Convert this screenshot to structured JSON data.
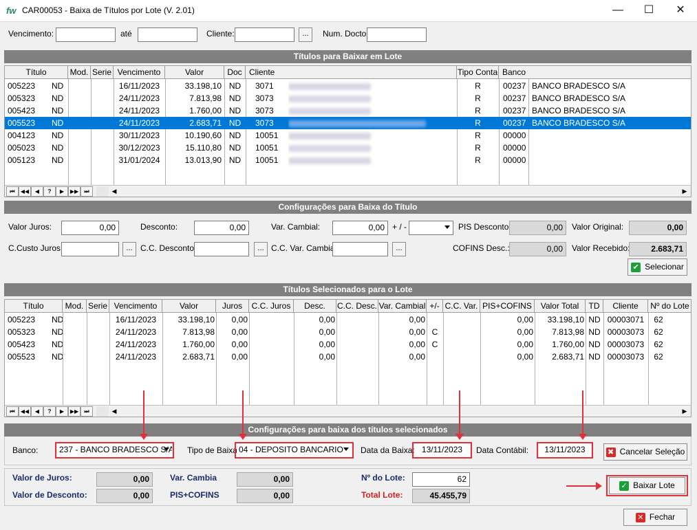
{
  "window": {
    "app_icon": "fw",
    "title": "CAR00053 - Baixa de Títulos por Lote   (V. 2.01)",
    "minimize": "—",
    "maximize": "☐",
    "close": "✕"
  },
  "filters": {
    "vencimento_label": "Vencimento:",
    "vencimento_from": "",
    "ate_label": "até",
    "vencimento_to": "",
    "cliente_label": "Cliente:",
    "cliente_value": "",
    "cliente_lookup": "...",
    "num_docto_label": "Num. Docto",
    "num_docto_value": ""
  },
  "titulos_baixar": {
    "section_title": "Títulos para Baixar em Lote",
    "headers": [
      "Título",
      "Mod.",
      "Serie",
      "Vencimento",
      "Valor",
      "Doc",
      "Cliente",
      "Tipo Conta",
      "Banco"
    ],
    "rows": [
      {
        "titulo": "005223",
        "tipo": "ND",
        "mod": "",
        "serie": "",
        "vencimento": "16/11/2023",
        "valor": "33.198,10",
        "doc": "ND",
        "cliente": "3071",
        "tipo_conta": "R",
        "banco": "00237",
        "banco_nome": "BANCO BRADESCO S/A",
        "selected": false
      },
      {
        "titulo": "005323",
        "tipo": "ND",
        "mod": "",
        "serie": "",
        "vencimento": "24/11/2023",
        "valor": "7.813,98",
        "doc": "ND",
        "cliente": "3073",
        "tipo_conta": "R",
        "banco": "00237",
        "banco_nome": "BANCO BRADESCO S/A",
        "selected": false
      },
      {
        "titulo": "005423",
        "tipo": "ND",
        "mod": "",
        "serie": "",
        "vencimento": "24/11/2023",
        "valor": "1.760,00",
        "doc": "ND",
        "cliente": "3073",
        "tipo_conta": "R",
        "banco": "00237",
        "banco_nome": "BANCO BRADESCO S/A",
        "selected": false
      },
      {
        "titulo": "005523",
        "tipo": "ND",
        "mod": "",
        "serie": "",
        "vencimento": "24/11/2023",
        "valor": "2.683,71",
        "doc": "ND",
        "cliente": "3073",
        "tipo_conta": "R",
        "banco": "00237",
        "banco_nome": "BANCO BRADESCO S/A",
        "selected": true
      },
      {
        "titulo": "004123",
        "tipo": "ND",
        "mod": "",
        "serie": "",
        "vencimento": "30/11/2023",
        "valor": "10.190,60",
        "doc": "ND",
        "cliente": "10051",
        "tipo_conta": "R",
        "banco": "00000",
        "banco_nome": "",
        "selected": false
      },
      {
        "titulo": "005023",
        "tipo": "ND",
        "mod": "",
        "serie": "",
        "vencimento": "30/12/2023",
        "valor": "15.110,80",
        "doc": "ND",
        "cliente": "10051",
        "tipo_conta": "R",
        "banco": "00000",
        "banco_nome": "",
        "selected": false
      },
      {
        "titulo": "005123",
        "tipo": "ND",
        "mod": "",
        "serie": "",
        "vencimento": "31/01/2024",
        "valor": "13.013,90",
        "doc": "ND",
        "cliente": "10051",
        "tipo_conta": "R",
        "banco": "00000",
        "banco_nome": "",
        "selected": false
      }
    ],
    "navigator": [
      "⏮",
      "◀◀",
      "◀",
      "?",
      "▶",
      "▶▶",
      "⏭"
    ]
  },
  "config_titulo": {
    "section_title": "Configurações para Baixa do Título",
    "valor_juros_label": "Valor Juros:",
    "valor_juros": "0,00",
    "desconto_label": "Desconto:",
    "desconto": "0,00",
    "var_cambial_label": "Var. Cambial:",
    "var_cambial": "0,00",
    "sinal_label": "+ / -",
    "sinal_value": "",
    "pis_desconto_label": "PIS Desconto:",
    "pis_desconto": "0,00",
    "valor_original_label": "Valor Original:",
    "valor_original": "0,00",
    "ccusto_juros_label": "C.Custo Juros:",
    "ccusto_juros": "",
    "cc_desconto_label": "C.C. Desconto:",
    "cc_desconto": "",
    "cc_var_cambial_label": "C.C. Var. Cambial:",
    "cc_var_cambial": "",
    "cofins_desc_label": "COFINS Desc.:",
    "cofins_desc": "0,00",
    "valor_recebido_label": "Valor Recebido:",
    "valor_recebido": "2.683,71",
    "lookup": "...",
    "selecionar_label": "Selecionar"
  },
  "titulos_selecionados": {
    "section_title": "Títulos Selecionados para o Lote",
    "headers": [
      "Título",
      "Mod.",
      "Serie",
      "Vencimento",
      "Valor",
      "Juros",
      "C.C. Juros",
      "Desc.",
      "C.C. Desc.",
      "Var. Cambial",
      "+/-",
      "C.C. Var.",
      "PIS+COFINS",
      "Valor Total",
      "TD",
      "Cliente",
      "Nº do Lote"
    ],
    "rows": [
      {
        "titulo": "005223",
        "tipo": "ND",
        "vencimento": "16/11/2023",
        "valor": "33.198,10",
        "juros": "0,00",
        "desc": "0,00",
        "var": "0,00",
        "sinal": "",
        "pis": "0,00",
        "total": "33.198,10",
        "td": "ND",
        "cliente": "00003071",
        "lote": "62"
      },
      {
        "titulo": "005323",
        "tipo": "ND",
        "vencimento": "24/11/2023",
        "valor": "7.813,98",
        "juros": "0,00",
        "desc": "0,00",
        "var": "0,00",
        "sinal": "C",
        "pis": "0,00",
        "total": "7.813,98",
        "td": "ND",
        "cliente": "00003073",
        "lote": "62"
      },
      {
        "titulo": "005423",
        "tipo": "ND",
        "vencimento": "24/11/2023",
        "valor": "1.760,00",
        "juros": "0,00",
        "desc": "0,00",
        "var": "0,00",
        "sinal": "C",
        "pis": "0,00",
        "total": "1.760,00",
        "td": "ND",
        "cliente": "00003073",
        "lote": "62"
      },
      {
        "titulo": "005523",
        "tipo": "ND",
        "vencimento": "24/11/2023",
        "valor": "2.683,71",
        "juros": "0,00",
        "desc": "0,00",
        "var": "0,00",
        "sinal": "",
        "pis": "0,00",
        "total": "2.683,71",
        "td": "ND",
        "cliente": "00003073",
        "lote": "62"
      }
    ]
  },
  "config_selecionados": {
    "section_title": "Configurações para baixa dos títulos selecionados",
    "banco_label": "Banco:",
    "banco": "237 - BANCO BRADESCO S/A",
    "tipo_baixa_label": "Tipo de Baixa:",
    "tipo_baixa": "04 - DEPOSITO BANCARIO",
    "data_baixa_label": "Data da Baixa:",
    "data_baixa": "13/11/2023",
    "data_contabil_label": "Data Contábil:",
    "data_contabil": "13/11/2023",
    "cancelar_label": "Cancelar Seleção"
  },
  "totais": {
    "valor_juros_label": "Valor de Juros:",
    "valor_juros": "0,00",
    "valor_desconto_label": "Valor de Desconto:",
    "valor_desconto": "0,00",
    "var_cambia_label": "Var. Cambia",
    "var_cambia": "0,00",
    "pis_cofins_label": "PIS+COFINS",
    "pis_cofins": "0,00",
    "num_lote_label": "Nº do Lote:",
    "num_lote": "62",
    "total_lote_label": "Total Lote:",
    "total_lote": "45.455,79",
    "baixar_lote_label": "Baixar Lote",
    "fechar_label": "Fechar"
  },
  "colors": {
    "selection": "#0078d7",
    "section_bar": "#808080",
    "annotation_red": "#e0303a",
    "navy_label": "#1a2a6c",
    "total_red": "#d21f1f"
  }
}
